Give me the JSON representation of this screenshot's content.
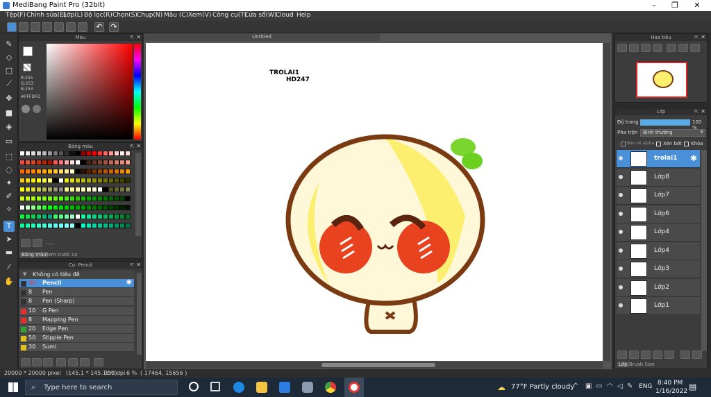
{
  "window": {
    "title": "MediBang Paint Pro (32bit)",
    "minimize": "–",
    "maximize": "❐",
    "close": "✕"
  },
  "menu": [
    "Tệp(F)",
    "Chỉnh sửa(E)",
    "Lớp(L)",
    "Bộ lọc(R)",
    "Chọn(S)",
    "Chụp(N)",
    "Màu (C)",
    "Xem(V)",
    "Công cụ(T)",
    "Cửa sổ(W)",
    "Cloud",
    "Help"
  ],
  "canvas": {
    "tab_title": "Untitled",
    "text_line1": "TROLAI1",
    "text_line2": "HD247"
  },
  "color_panel": {
    "title": "Màu",
    "r": "R:255",
    "g": "G:253",
    "b": "B:253",
    "hex": "#FFFDFD",
    "fg_color": "#ffffff",
    "bg_color": "#e83a1f"
  },
  "swatch_panel": {
    "title": "Bảng màu",
    "tabs": [
      "Bảng màu",
      "Xem trước cọ"
    ],
    "dots": "....."
  },
  "brush_panel": {
    "title": "Cọ: Pencil",
    "group": "Không có tiêu đề",
    "brushes": [
      {
        "size": "40",
        "name": "Pencil",
        "color": "#333333",
        "selected": true
      },
      {
        "size": "8",
        "name": "Pen",
        "color": "#333333"
      },
      {
        "size": "8",
        "name": "Pen (Sharp)",
        "color": "#333333"
      },
      {
        "size": "10",
        "name": "G Pen",
        "color": "#e03030"
      },
      {
        "size": "8",
        "name": "Mapping Pen",
        "color": "#e03030"
      },
      {
        "size": "20",
        "name": "Edge Pen",
        "color": "#30a030"
      },
      {
        "size": "50",
        "name": "Stipple Pen",
        "color": "#e0c020"
      },
      {
        "size": "30",
        "name": "Sumi",
        "color": "#e0c020"
      }
    ]
  },
  "navigator": {
    "title": "Hoa tiêu"
  },
  "layer_panel": {
    "title": "Lớp",
    "opacity_label": "Độ trong",
    "opacity_value": "100 %",
    "opacity": 1.0,
    "blend_label": "Pha trộn",
    "blend_value": "Bình thường",
    "protect_alpha": "Bảo vệ alpha",
    "clipping": "Xén bớt",
    "lock": "Khóa",
    "layers": [
      "trolai1",
      "Lớp8",
      "Lớp7",
      "Lớp6",
      "Lớp4",
      "Lớp4",
      "Lớp3",
      "Lớp2",
      "Lớp1"
    ],
    "bottom_tabs": [
      "Lớp",
      "Brush Size"
    ]
  },
  "status": {
    "size": "20000 * 20000 pixel",
    "cm": "(145.1 * 145.1cm)",
    "dpi": "350 dpi",
    "zoom": "6 %",
    "coords": "( 17464, 15656 )"
  },
  "taskbar": {
    "search_placeholder": "Type here to search",
    "weather": "77°F  Partly cloudy",
    "lang": "ENG",
    "time": "8:40 PM",
    "date": "1/16/2022"
  }
}
